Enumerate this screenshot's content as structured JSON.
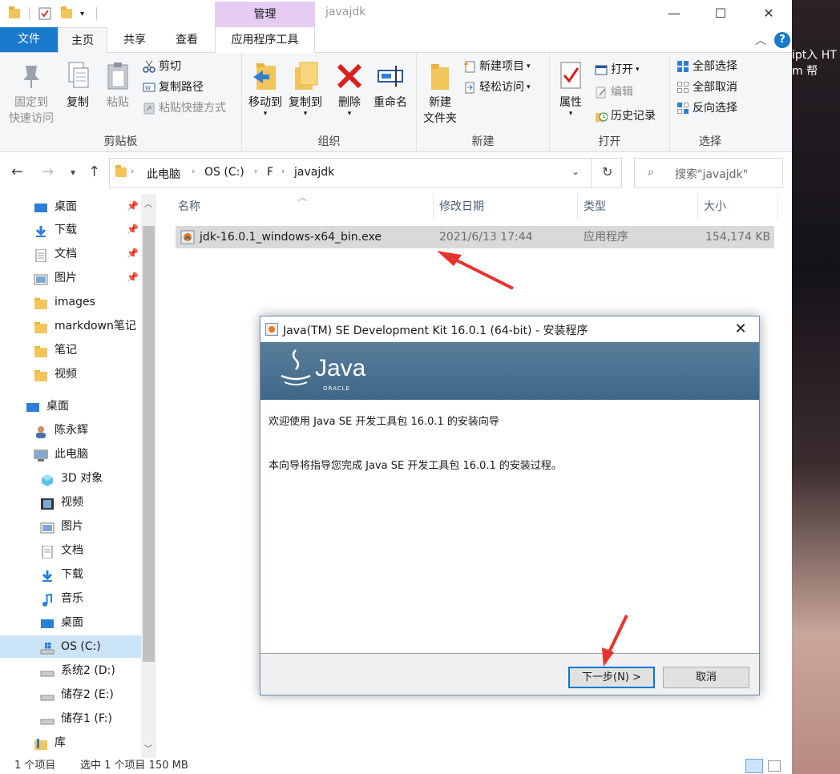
{
  "window": {
    "title": "javajdk",
    "manage_tab": "管理",
    "controls": {
      "minimize": "—",
      "maximize": "☐",
      "close": "✕"
    }
  },
  "ribbon_tabs": {
    "file": "文件",
    "home": "主页",
    "share": "共享",
    "view": "查看",
    "app_tools": "应用程序工具"
  },
  "ribbon": {
    "clipboard": {
      "label": "剪贴板",
      "pin": [
        "固定到",
        "快速访问"
      ],
      "copy": "复制",
      "paste": "粘贴",
      "cut": "剪切",
      "copy_path": "复制路径",
      "paste_shortcut": "粘贴快捷方式"
    },
    "organize": {
      "label": "组织",
      "move_to": "移动到",
      "copy_to": "复制到",
      "delete": "删除",
      "rename": "重命名"
    },
    "new": {
      "label": "新建",
      "new_folder": [
        "新建",
        "文件夹"
      ],
      "new_item": "新建项目",
      "easy_access": "轻松访问"
    },
    "open": {
      "label": "打开",
      "properties": "属性",
      "open": "打开",
      "edit": "编辑",
      "history": "历史记录"
    },
    "select": {
      "label": "选择",
      "select_all": "全部选择",
      "select_none": "全部取消",
      "invert": "反向选择"
    }
  },
  "address": {
    "crumbs": [
      "此电脑",
      "OS (C:)",
      "F",
      "javajdk"
    ],
    "search_placeholder": "搜索\"javajdk\""
  },
  "nav_pane": {
    "quick": [
      "桌面",
      "下载",
      "文档",
      "图片",
      "images",
      "markdown笔记",
      "笔记",
      "视频"
    ],
    "tree": [
      "桌面",
      "陈永辉",
      "此电脑",
      "3D 对象",
      "视频",
      "图片",
      "文档",
      "下载",
      "音乐",
      "桌面",
      "OS (C:)",
      "系统2 (D:)",
      "储存2 (E:)",
      "储存1 (F:)",
      "库"
    ]
  },
  "columns": {
    "name": "名称",
    "modified": "修改日期",
    "type": "类型",
    "size": "大小"
  },
  "files": [
    {
      "name": "jdk-16.0.1_windows-x64_bin.exe",
      "modified": "2021/6/13 17:44",
      "type": "应用程序",
      "size": "154,174 KB"
    }
  ],
  "status": {
    "count": "1 个项目",
    "selected": "选中 1 个项目  150 MB"
  },
  "desktop": {
    "line1": "ipt入  HT",
    "line2": "m     帮"
  },
  "installer": {
    "title": "Java(TM) SE Development Kit 16.0.1 (64-bit) - 安装程序",
    "logo_text": "Java",
    "logo_sub": "ORACLE",
    "welcome": "欢迎使用 Java SE 开发工具包 16.0.1 的安装向导",
    "body": "本向导将指导您完成 Java SE 开发工具包 16.0.1 的安装过程。",
    "next": "下一步(N) >",
    "cancel": "取消"
  },
  "colors": {
    "accent": "#1979ca",
    "manage": "#e6ccf2",
    "arrow": "#e8332c"
  }
}
